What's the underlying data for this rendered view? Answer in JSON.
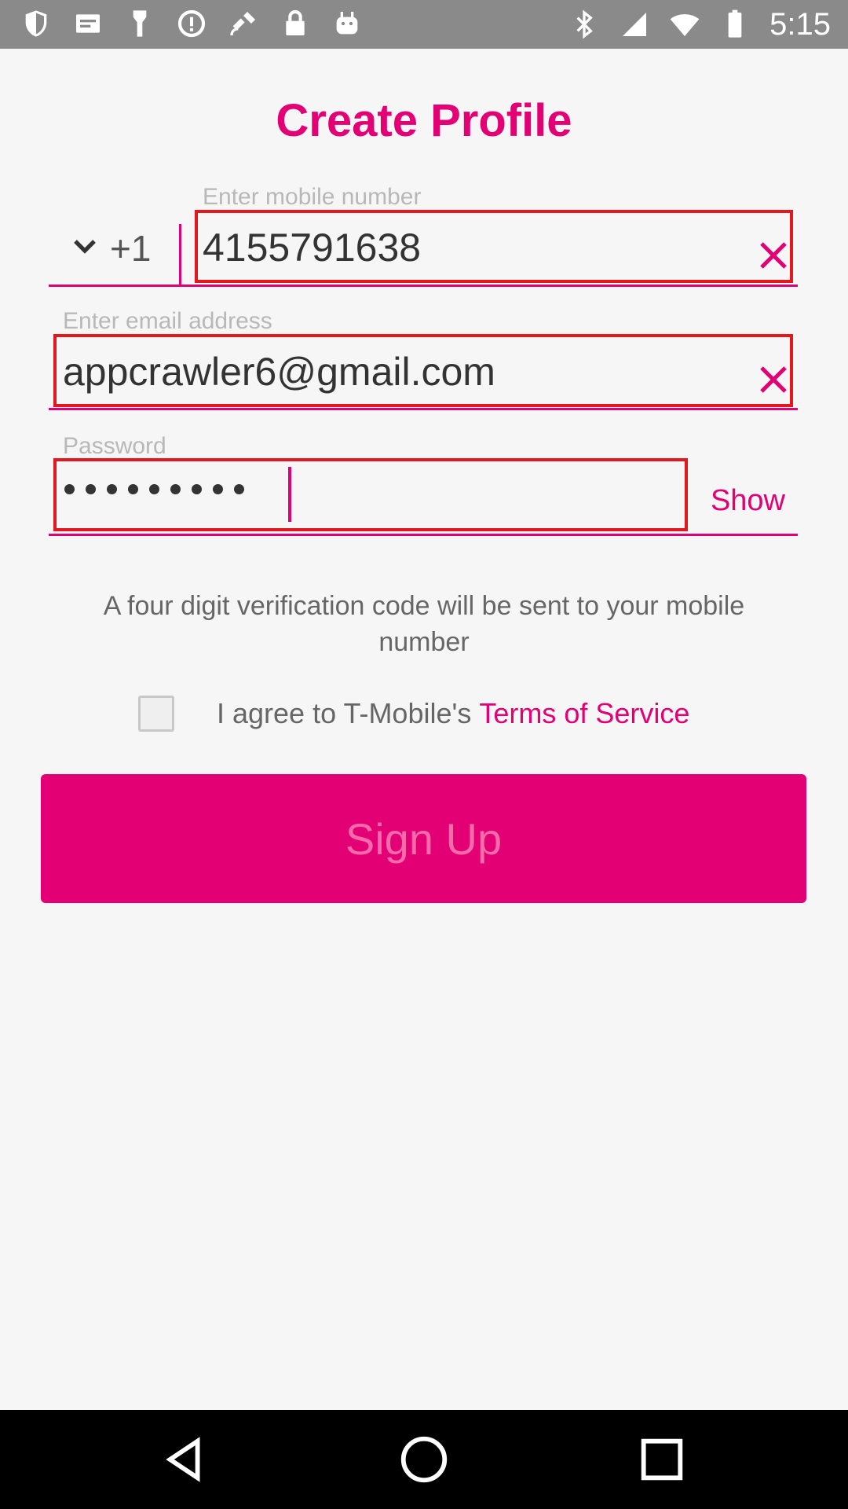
{
  "status_bar": {
    "time": "5:15",
    "left_icons": [
      "shield-icon",
      "message-icon",
      "flashlight-icon",
      "info-circle-icon",
      "satellite-fake-gps-icon",
      "lock-icon",
      "android-icon"
    ],
    "right_icons": [
      "bluetooth-icon",
      "signal-icon",
      "wifi-icon",
      "battery-icon"
    ]
  },
  "page": {
    "title": "Create Profile"
  },
  "phone": {
    "label": "Enter mobile number",
    "country_code": "+1",
    "value": "4155791638"
  },
  "email": {
    "label": "Enter email address",
    "value": "appcrawler6@gmail.com"
  },
  "password": {
    "label": "Password",
    "masked_length": 9,
    "show_label": "Show"
  },
  "info": {
    "text": "A four digit verification code will be sent to your mobile number"
  },
  "agreement": {
    "text": "I agree to T-Mobile's",
    "link": "Terms of Service",
    "checked": false
  },
  "signup": {
    "label": "Sign Up"
  },
  "colors": {
    "accent": "#e20074",
    "highlight_box": "#e3171e",
    "background": "#f6f6f6"
  },
  "nav_bar": {
    "buttons": [
      "back-icon",
      "home-icon",
      "recents-icon"
    ]
  }
}
